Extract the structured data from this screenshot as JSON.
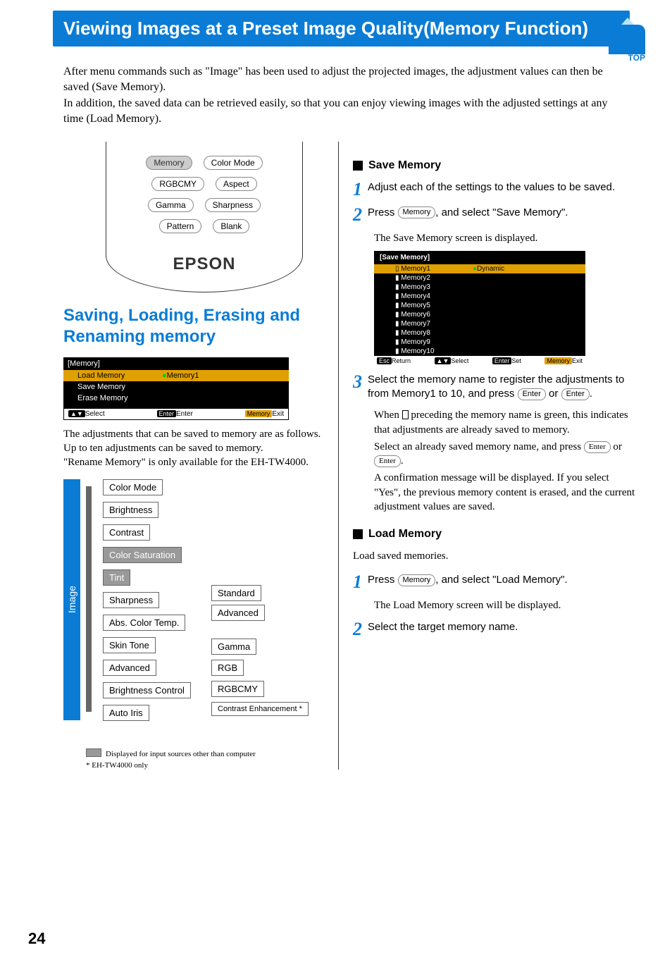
{
  "page_number": "24",
  "title": "Viewing Images at a Preset Image Quality(Memory Function)",
  "top_label": "TOP",
  "intro_p1": "After menu commands such as \"Image\" has been used to adjust the projected images, the adjustment values can then be saved (Save Memory).",
  "intro_p2": "In addition, the saved data can be retrieved easily, so that you can enjoy viewing images with the adjusted settings at any time (Load Memory).",
  "remote": {
    "memory": "Memory",
    "color_mode": "Color Mode",
    "rgbcmy": "RGBCMY",
    "aspect": "Aspect",
    "gamma": "Gamma",
    "sharpness": "Sharpness",
    "pattern": "Pattern",
    "blank": "Blank",
    "brand": "EPSON"
  },
  "section_heading": "Saving, Loading, Erasing and Renaming memory",
  "osd_memory": {
    "title": "[Memory]",
    "load": "Load Memory",
    "load_val": "Memory1",
    "save": "Save Memory",
    "erase": "Erase Memory",
    "foot_select": "Select",
    "foot_enter": "Enter",
    "foot_exit": "Exit",
    "badge_enter": "Enter",
    "badge_memory": "Memory"
  },
  "left_p1": "The adjustments that can be saved to memory are as follows.",
  "left_p2": "Up to ten adjustments can be saved to memory.",
  "left_p3": "\"Rename Memory\" is only available for the EH-TW4000.",
  "tree": {
    "image": "Image",
    "items": [
      "Color Mode",
      "Brightness",
      "Contrast",
      "Color Saturation",
      "Tint",
      "Sharpness",
      "Abs. Color Temp.",
      "Skin Tone",
      "Advanced",
      "Brightness Control",
      "Auto Iris"
    ],
    "sub_sharpness": [
      "Standard",
      "Advanced"
    ],
    "sub_advanced": [
      "Gamma",
      "RGB",
      "RGBCMY",
      "Contrast Enhancement *"
    ]
  },
  "footnote1": "Displayed for input sources other than computer",
  "footnote2": "* EH-TW4000 only",
  "save_memory": {
    "heading": "Save Memory",
    "step1": "Adjust each of the settings to the values to be saved.",
    "step2_a": "Press ",
    "step2_b": ", and select \"Save Memory\".",
    "step2_note": "The Save Memory screen is displayed.",
    "step3_a": "Select the memory name to register the adjustments to from Memory1 to 10, and press ",
    "step3_b": " or ",
    "step3_c": ".",
    "step3_note1_a": "When ",
    "step3_note1_b": " preceding the memory name is green, this indicates that adjustments are already saved to memory.",
    "step3_note2_a": "Select an already saved memory name, and press ",
    "step3_note2_b": " or ",
    "step3_note2_c": ".",
    "step3_note3": "A confirmation message will be displayed. If you select \"Yes\", the previous memory content is erased, and the current adjustment values are saved."
  },
  "osd_save": {
    "title": "[Save Memory]",
    "rows": [
      "Memory1",
      "Memory2",
      "Memory3",
      "Memory4",
      "Memory5",
      "Memory6",
      "Memory7",
      "Memory8",
      "Memory9",
      "Memory10"
    ],
    "val1": "Dynamic",
    "foot_return": "Return",
    "foot_select": "Select",
    "foot_set": "Set",
    "foot_exit": "Exit",
    "badge_esc": "Esc",
    "badge_enter": "Enter",
    "badge_memory": "Memory"
  },
  "load_memory": {
    "heading": "Load Memory",
    "intro": "Load saved memories.",
    "step1_a": "Press ",
    "step1_b": ", and select \"Load Memory\".",
    "step1_note": "The Load Memory screen will be displayed.",
    "step2": "Select the target memory name."
  },
  "inline_buttons": {
    "memory": "Memory",
    "enter": "Enter"
  }
}
